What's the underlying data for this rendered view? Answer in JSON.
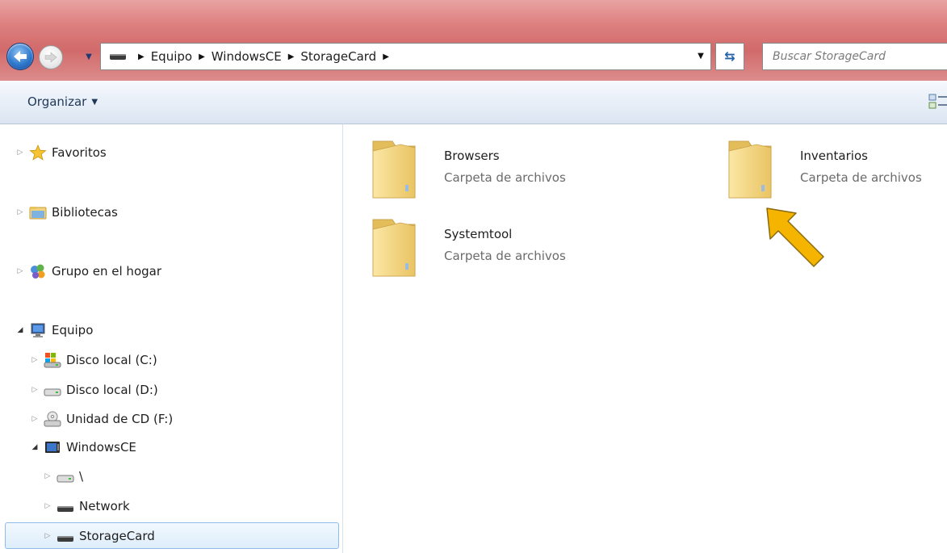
{
  "address_bar": {
    "breadcrumbs": [
      "Equipo",
      "WindowsCE",
      "StorageCard"
    ],
    "search_placeholder": "Buscar StorageCard"
  },
  "toolbar": {
    "organize_label": "Organizar"
  },
  "nav_pane": {
    "items": [
      {
        "label": "Favoritos",
        "icon": "star-icon"
      },
      {
        "label": "Bibliotecas",
        "icon": "libraries-icon"
      },
      {
        "label": "Grupo en el hogar",
        "icon": "homegroup-icon"
      },
      {
        "label": "Equipo",
        "icon": "computer-icon"
      },
      {
        "label": "Disco local (C:)",
        "icon": "system-drive-icon"
      },
      {
        "label": "Disco local (D:)",
        "icon": "drive-icon"
      },
      {
        "label": "Unidad de CD (F:)",
        "icon": "cd-drive-icon"
      },
      {
        "label": "WindowsCE",
        "icon": "device-icon"
      },
      {
        "label": "\\",
        "icon": "drive-icon"
      },
      {
        "label": "Network",
        "icon": "drive-icon"
      },
      {
        "label": "StorageCard",
        "icon": "drive-icon"
      }
    ]
  },
  "content": {
    "folders": [
      {
        "name": "Browsers",
        "type": "Carpeta de archivos"
      },
      {
        "name": "Inventarios",
        "type": "Carpeta de archivos"
      },
      {
        "name": "Systemtool",
        "type": "Carpeta de archivos"
      }
    ]
  },
  "colors": {
    "titlebar": "#d26a6a",
    "selection_border": "#8fbbe8",
    "arrow": "#f5b400"
  }
}
